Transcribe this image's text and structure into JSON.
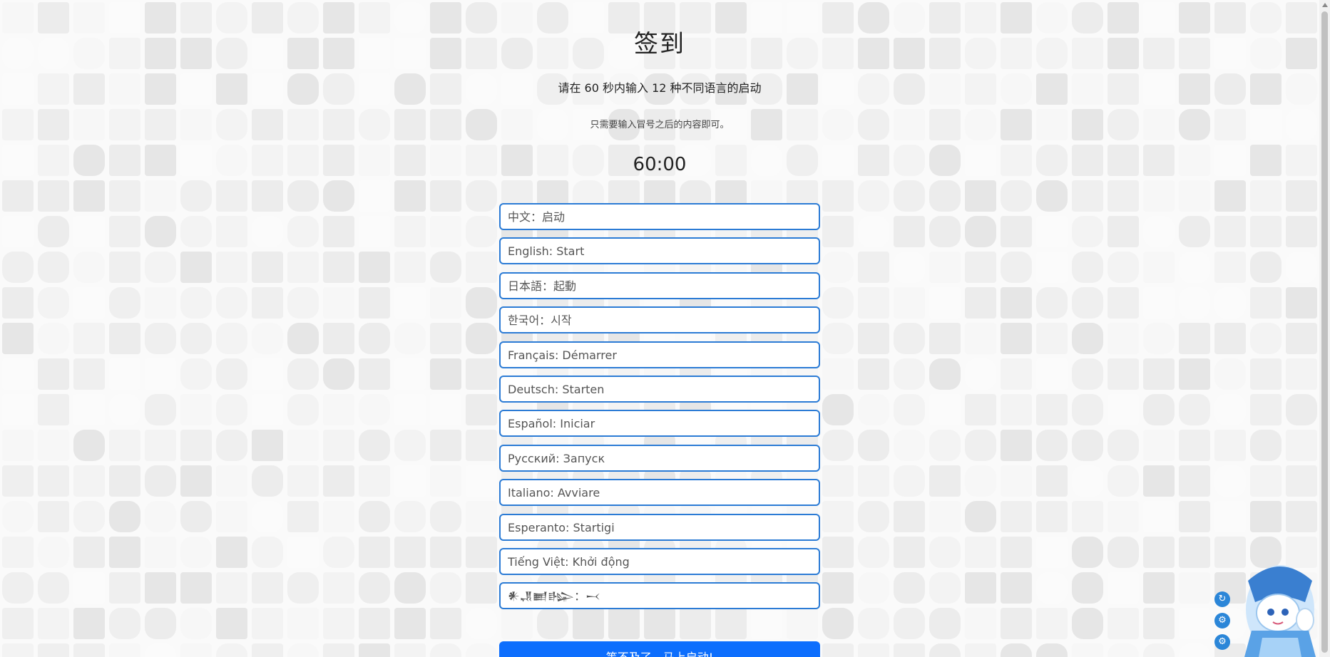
{
  "page": {
    "title": "签到",
    "instruction": "请在 60 秒内输入 12 种不同语言的启动",
    "note": "只需要输入冒号之后的内容即可。",
    "timer": "60:00"
  },
  "fields": [
    {
      "placeholder": "中文：启动"
    },
    {
      "placeholder": "English: Start"
    },
    {
      "placeholder": "日本語：起動"
    },
    {
      "placeholder": "한국어：시작"
    },
    {
      "placeholder": "Français: Démarrer"
    },
    {
      "placeholder": "Deutsch: Starten"
    },
    {
      "placeholder": "Español: Iniciar"
    },
    {
      "placeholder": "Русский: Запуск"
    },
    {
      "placeholder": "Italiano: Avviare"
    },
    {
      "placeholder": "Esperanto: Startigi"
    },
    {
      "placeholder": "Tiếng Việt: Khởi động"
    },
    {
      "placeholder": "𒀭𒂗𒆤𒈗：𒁁"
    }
  ],
  "submit": {
    "label": "等不及了，马上启动!"
  },
  "floating_buttons": [
    {
      "icon": "refresh-icon"
    },
    {
      "icon": "settings-icon"
    },
    {
      "icon": "gear-icon"
    }
  ],
  "colors": {
    "field_border": "#2b7bd5",
    "submit_bg": "#0d6efd"
  }
}
